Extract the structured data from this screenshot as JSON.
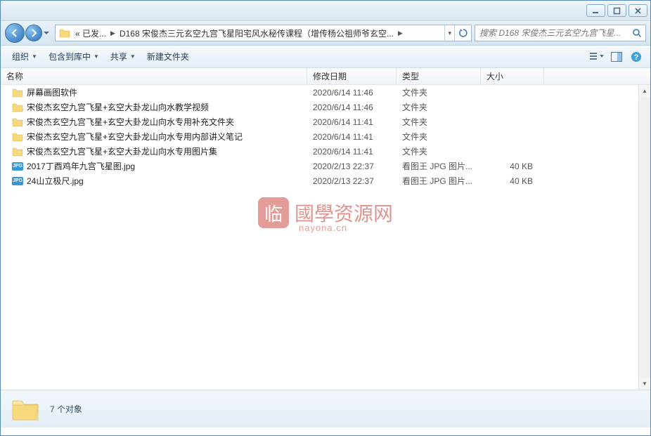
{
  "breadcrumb": {
    "prefix": "« 已发...",
    "folder": "D168 宋俊杰三元玄空九宫飞星阳宅风水秘传课程（增传杨公祖师爷玄空..."
  },
  "search": {
    "placeholder": "搜索 D168 宋俊杰三元玄空九宫飞星..."
  },
  "toolbar": {
    "organize": "组织",
    "include": "包含到库中",
    "share": "共享",
    "newfolder": "新建文件夹"
  },
  "columns": {
    "name": "名称",
    "date": "修改日期",
    "type": "类型",
    "size": "大小"
  },
  "files": [
    {
      "icon": "folder",
      "name": "屏幕画图软件",
      "date": "2020/6/14 11:46",
      "type": "文件夹",
      "size": ""
    },
    {
      "icon": "folder",
      "name": "宋俊杰玄空九宫飞星+玄空大卦龙山向水教学视频",
      "date": "2020/6/14 11:46",
      "type": "文件夹",
      "size": ""
    },
    {
      "icon": "folder",
      "name": "宋俊杰玄空九宫飞星+玄空大卦龙山向水专用补充文件夹",
      "date": "2020/6/14 11:41",
      "type": "文件夹",
      "size": ""
    },
    {
      "icon": "folder",
      "name": "宋俊杰玄空九宫飞星+玄空大卦龙山向水专用内部讲义笔记",
      "date": "2020/6/14 11:41",
      "type": "文件夹",
      "size": ""
    },
    {
      "icon": "folder",
      "name": "宋俊杰玄空九宫飞星+玄空大卦龙山向水专用图片集",
      "date": "2020/6/14 11:41",
      "type": "文件夹",
      "size": ""
    },
    {
      "icon": "jpg",
      "name": "2017丁酉鸡年九宫飞星图.jpg",
      "date": "2020/2/13 22:37",
      "type": "看图王 JPG 图片...",
      "size": "40 KB"
    },
    {
      "icon": "jpg",
      "name": "24山立极尺.jpg",
      "date": "2020/2/13 22:37",
      "type": "看图王 JPG 图片...",
      "size": "40 KB"
    }
  ],
  "status": {
    "count": "7 个对象"
  },
  "watermark": {
    "seal": "临",
    "text": "國學资源网",
    "sub": "nayona.cn"
  }
}
